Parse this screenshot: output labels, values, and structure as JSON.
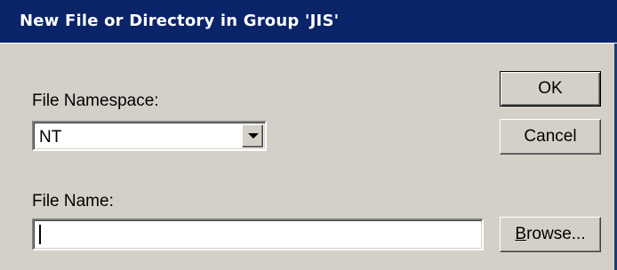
{
  "window": {
    "title": "New File or Directory in Group 'JIS'"
  },
  "form": {
    "namespace_label": "File Namespace:",
    "namespace_value": "NT",
    "filename_label": "File Name:",
    "filename_value": ""
  },
  "buttons": {
    "ok": "OK",
    "cancel": "Cancel",
    "browse": "Browse..."
  },
  "colors": {
    "titlebar": "#0a246a",
    "face": "#d4d0c8"
  },
  "icons": {
    "dropdown": "chevron-down-icon"
  }
}
